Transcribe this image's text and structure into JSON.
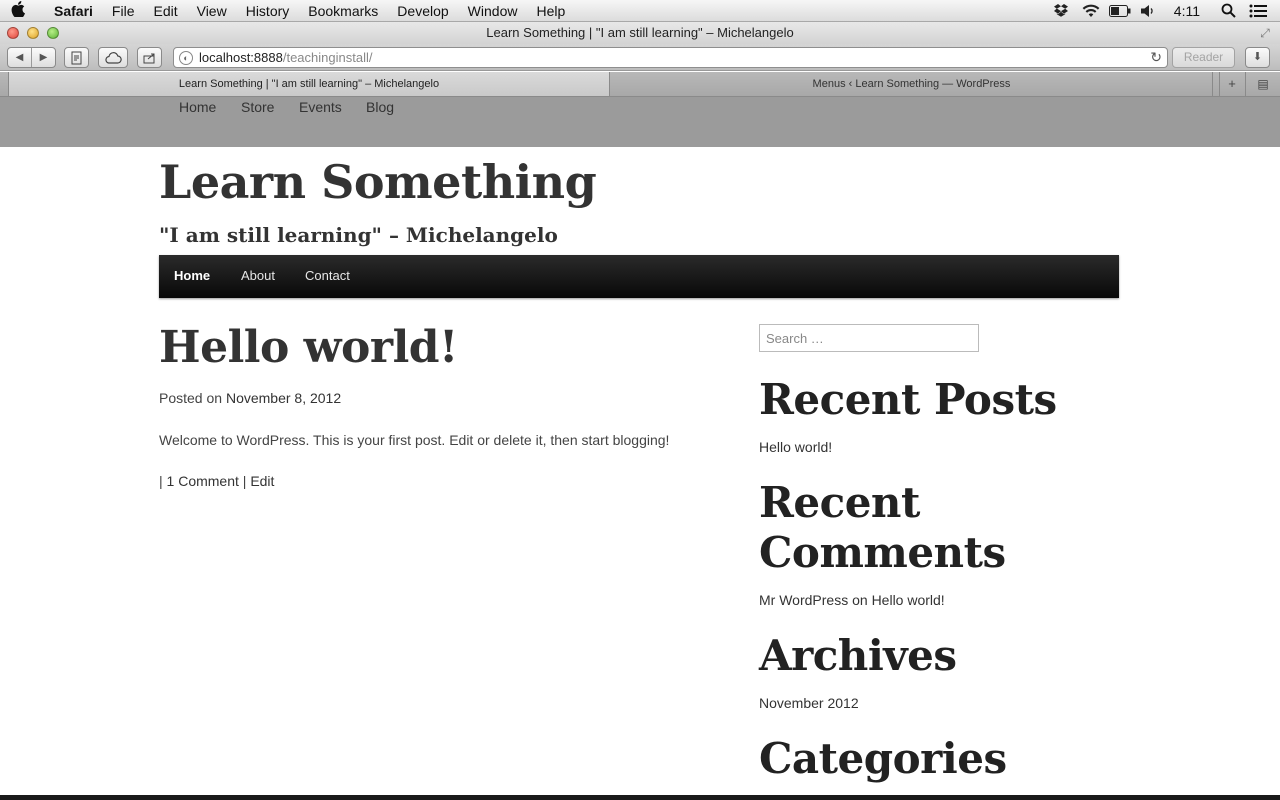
{
  "os_menubar": {
    "app_name": "Safari",
    "menus": [
      "File",
      "Edit",
      "View",
      "History",
      "Bookmarks",
      "Develop",
      "Window",
      "Help"
    ],
    "tray_icons": [
      "dropbox-icon",
      "wifi-icon",
      "battery-icon",
      "volume-icon"
    ],
    "clock": "4:11"
  },
  "window": {
    "title": "Learn Something | \"I am still learning\" – Michelangelo"
  },
  "toolbar": {
    "url_host": "localhost:8888",
    "url_path": "/teachinginstall/",
    "reader_label": "Reader"
  },
  "tabs": [
    {
      "label": "Learn Something | \"I am still learning\" – Michelangelo",
      "active": true
    },
    {
      "label": "Menus ‹ Learn Something — WordPress",
      "active": false
    }
  ],
  "custom_menu": [
    "Home",
    "Store",
    "Events",
    "Blog"
  ],
  "site": {
    "title": "Learn Something",
    "description": "\"I am still learning\" – Michelangelo"
  },
  "main_nav": [
    "Home",
    "About",
    "Contact"
  ],
  "post": {
    "title": "Hello world!",
    "meta_prefix": "Posted on",
    "date": "November 8, 2012",
    "content": "Welcome to WordPress. This is your first post. Edit or delete it, then start blogging!",
    "footer_sep": "|",
    "comments_link": "1 Comment",
    "footer_sep2": "|",
    "edit_link": "Edit"
  },
  "sidebar": {
    "search_placeholder": "Search …",
    "recent_posts_title": "Recent Posts",
    "recent_posts": [
      "Hello world!"
    ],
    "recent_comments_title_line1": "Recent",
    "recent_comments_title_line2": "Comments",
    "comment_author": "Mr WordPress",
    "comment_on": "on",
    "comment_post": "Hello world!",
    "archives_title": "Archives",
    "archives": [
      "November 2012"
    ],
    "categories_title": "Categories"
  }
}
